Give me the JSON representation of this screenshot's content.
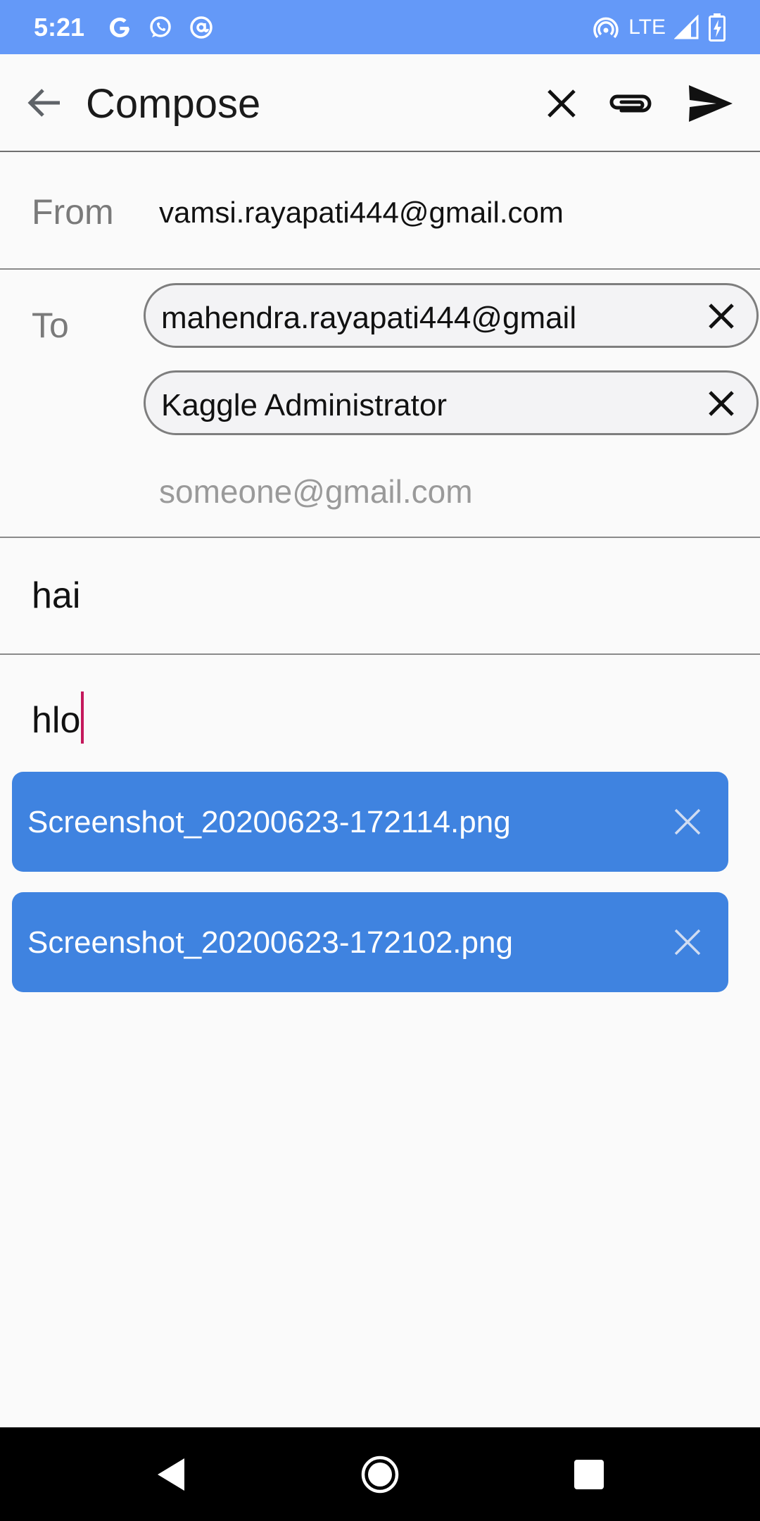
{
  "status_bar": {
    "time": "5:21",
    "left_icons": [
      "google-icon",
      "whatsapp-icon",
      "at-sign-icon"
    ],
    "network": "LTE",
    "right_icons": [
      "hotspot-icon",
      "signal-icon",
      "battery-charging-icon"
    ],
    "background": "#6499f8"
  },
  "app_bar": {
    "title": "Compose",
    "actions": [
      "back-arrow-icon",
      "close-icon",
      "paperclip-icon",
      "send-icon"
    ]
  },
  "from": {
    "label": "From",
    "value": "vamsi.rayapati444@gmail.com"
  },
  "to": {
    "label": "To",
    "recipients": [
      {
        "text": "mahendra.rayapati444@gmail"
      },
      {
        "text": "Kaggle Administrator"
      }
    ],
    "placeholder": "someone@gmail.com"
  },
  "subject": {
    "value": "hai"
  },
  "body": {
    "value": "hlo"
  },
  "attachments": [
    {
      "name": "Screenshot_20200623-172114.png"
    },
    {
      "name": "Screenshot_20200623-172102.png"
    }
  ],
  "colors": {
    "attachment_bg": "#3f83e0",
    "cursor": "#c4185c"
  }
}
